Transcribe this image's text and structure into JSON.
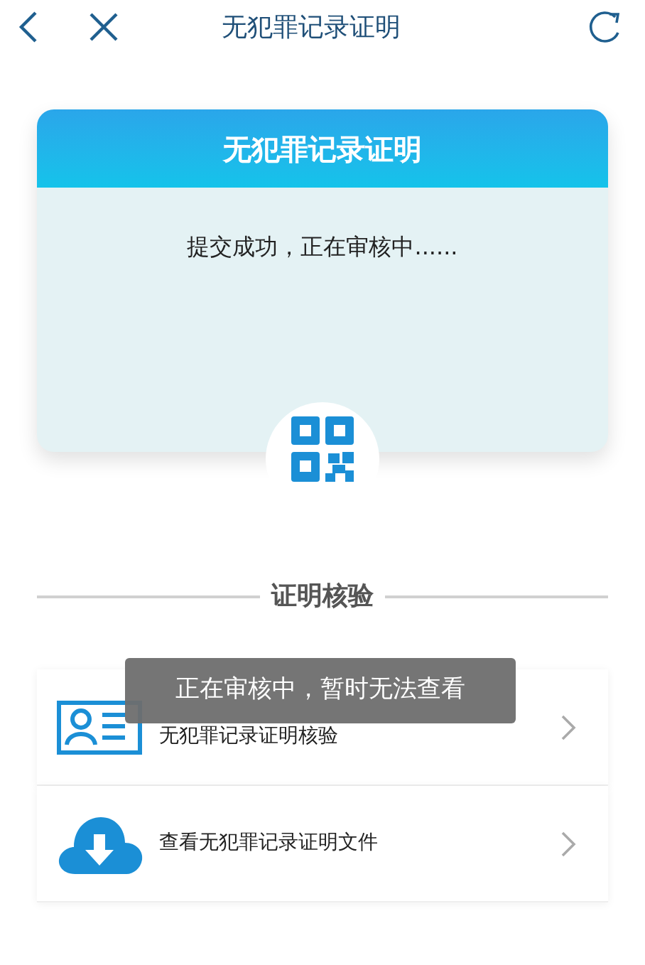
{
  "nav": {
    "title": "无犯罪记录证明"
  },
  "card": {
    "title": "无犯罪记录证明",
    "status": "提交成功，正在审核中......"
  },
  "section": {
    "title": "证明核验"
  },
  "rows": [
    {
      "kind": "id-card",
      "label": "无犯罪记录证明核验"
    },
    {
      "kind": "cloud-download",
      "label": "查看无犯罪记录证明文件"
    }
  ],
  "toast": "正在审核中，暂时无法查看"
}
